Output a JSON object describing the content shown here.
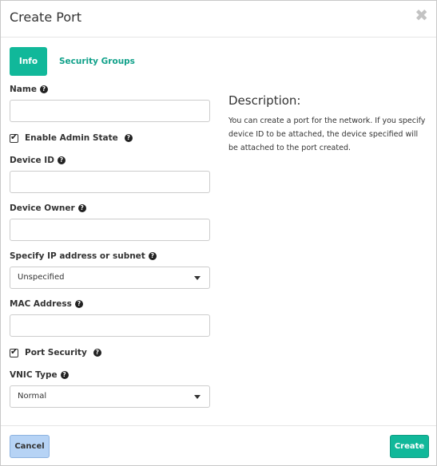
{
  "modal": {
    "title": "Create Port",
    "close_glyph": "✖"
  },
  "tabs": [
    {
      "label": "Info",
      "active": true
    },
    {
      "label": "Security Groups",
      "active": false
    }
  ],
  "form": {
    "name": {
      "label": "Name",
      "value": ""
    },
    "admin_state": {
      "label": "Enable Admin State",
      "checked": true
    },
    "device_id": {
      "label": "Device ID",
      "value": ""
    },
    "device_owner": {
      "label": "Device Owner",
      "value": ""
    },
    "ip_subnet": {
      "label": "Specify IP address or subnet",
      "selected": "Unspecified"
    },
    "mac_address": {
      "label": "MAC Address",
      "value": ""
    },
    "port_security": {
      "label": "Port Security",
      "checked": true
    },
    "vnic_type": {
      "label": "VNIC Type",
      "selected": "Normal"
    }
  },
  "description": {
    "title": "Description:",
    "text": "You can create a port for the network. If you specify device ID to be attached, the device specified will be attached to the port created."
  },
  "footer": {
    "cancel_label": "Cancel",
    "create_label": "Create"
  },
  "icons": {
    "help": "?",
    "check": "✔"
  },
  "colors": {
    "accent": "#11b89a",
    "cancel_bg": "#b6d3f5"
  }
}
